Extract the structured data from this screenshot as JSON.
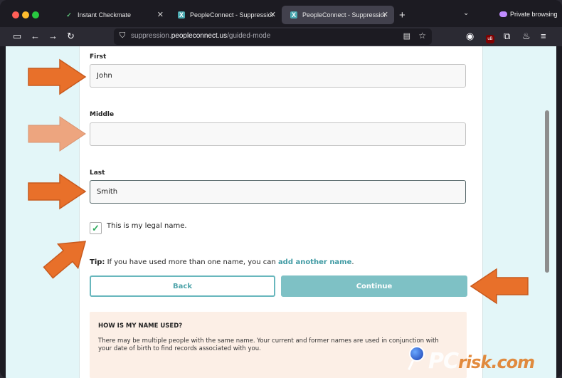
{
  "browser": {
    "tabs": [
      {
        "title": "Instant Checkmate",
        "active": false,
        "icon": "checkmark-icon"
      },
      {
        "title": "PeopleConnect - Suppression C",
        "active": false,
        "icon": "peopleconnect-icon"
      },
      {
        "title": "PeopleConnect - Suppression C",
        "active": true,
        "icon": "peopleconnect-icon"
      }
    ],
    "new_tab": "+",
    "private_label": "Private browsing",
    "url_prefix": "suppression.",
    "url_domain": "peopleconnect.us",
    "url_path": "/guided-mode"
  },
  "form": {
    "first_label": "First",
    "first_value": "John",
    "middle_label": "Middle",
    "middle_value": "",
    "last_label": "Last",
    "last_value": "Smith",
    "legal_name_label": "This is my legal name.",
    "legal_name_checked": true,
    "tip_bold": "Tip:",
    "tip_text": "If you have used more than one name, you can",
    "tip_link": "add another name",
    "tip_end": ".",
    "back_label": "Back",
    "continue_label": "Continue"
  },
  "info": {
    "heading": "HOW IS MY NAME USED?",
    "body": "There may be multiple people with the same name. Your current and former names are used in conjunction with your date of birth to find records associated with you."
  },
  "watermark": {
    "pc": "PC",
    "risk": "risk.com"
  },
  "colors": {
    "accent": "#4fa4aa",
    "continue_bg": "#7ec1c5",
    "arrow": "#e8702a",
    "arrow_faded": "#eda57f",
    "page_bg": "#e3f6f8",
    "info_bg": "#fcefe6"
  }
}
